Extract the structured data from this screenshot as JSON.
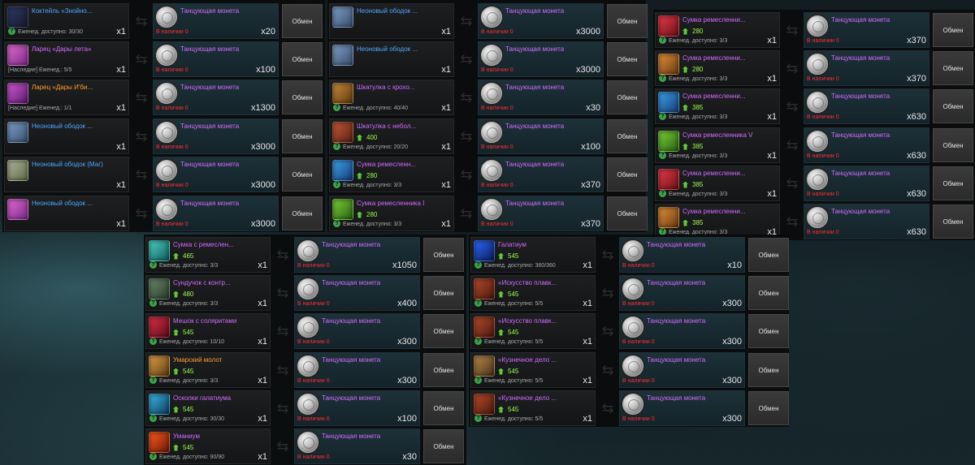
{
  "colors": {
    "item_name_blue": "#4fa6ff",
    "item_name_purple": "#d26bff",
    "item_name_orange": "#ff9d2a",
    "price_green": "#9cff4a",
    "stock_red": "#ff2d2d"
  },
  "common": {
    "currency_name": "Танцующая монета",
    "in_stock_text": "В наличии 0",
    "exchange_label": "Обмен"
  },
  "panels": [
    {
      "rows": [
        {
          "icon": "cocktail-icon",
          "icon_class": "ic-cocktail",
          "name": "Коктейль «Знойно...",
          "name_color": "blue",
          "price": "",
          "stock": "Еженед. доступно: 30/30",
          "qmark": true,
          "qty": "x1",
          "cost": "x20"
        },
        {
          "icon": "chest-icon",
          "icon_class": "ic-chest-pink",
          "name": "Ларец «Дары лета»",
          "name_color": "purple",
          "price": "",
          "stock": "[Наследие] Еженед.: 5/5",
          "qmark": false,
          "qty": "x1",
          "cost": "x100"
        },
        {
          "icon": "chest-icon",
          "icon_class": "ic-chest-purple",
          "name": "Ларец «Дары И'би...",
          "name_color": "orange",
          "price": "",
          "stock": "[Наследие] Еженед.: 1/1",
          "qmark": false,
          "qty": "x1",
          "cost": "x1300"
        },
        {
          "icon": "neon-rim-icon",
          "icon_class": "ic-chest-neon",
          "name": "Неоновый ободок ...",
          "name_color": "blue",
          "price": "",
          "stock": "",
          "qmark": false,
          "qty": "x1",
          "cost": "x3000"
        },
        {
          "icon": "neon-rim-icon",
          "icon_class": "ic-chest-green",
          "name": "Неоновый ободок (Маг)",
          "name_color": "blue",
          "price": "",
          "stock": "",
          "qmark": false,
          "qty": "x1",
          "cost": "x3000"
        },
        {
          "icon": "neon-rim-icon",
          "icon_class": "ic-chest-pink",
          "name": "Неоновый ободок ...",
          "name_color": "blue",
          "price": "",
          "stock": "",
          "qmark": false,
          "qty": "x1",
          "cost": "x3000"
        }
      ]
    },
    {
      "rows": [
        {
          "icon": "neon-rim-icon",
          "icon_class": "ic-chest-neon",
          "name": "Неоновый ободок ...",
          "name_color": "blue",
          "price": "",
          "stock": "",
          "qmark": false,
          "qty": "x1",
          "cost": "x3000"
        },
        {
          "icon": "neon-rim-icon",
          "icon_class": "ic-chest-neon",
          "name": "Неоновый ободок ...",
          "name_color": "blue",
          "price": "",
          "stock": "",
          "qmark": false,
          "qty": "x1",
          "cost": "x3000"
        },
        {
          "icon": "box-icon",
          "icon_class": "ic-box-brown",
          "name": "Шкатулка с крохо...",
          "name_color": "purple",
          "price": "",
          "stock": "Еженед. доступно: 40/40",
          "qmark": true,
          "qty": "x1",
          "cost": "x30"
        },
        {
          "icon": "box-icon",
          "icon_class": "ic-box-red",
          "name": "Шкатулка с небол...",
          "name_color": "purple",
          "price": "400",
          "stock": "Еженед. доступно: 20/20",
          "qmark": true,
          "qty": "x1",
          "cost": "x100"
        },
        {
          "icon": "bag-icon",
          "icon_class": "ic-bag-blue",
          "name": "Сумка ремесленн...",
          "name_color": "purple",
          "price": "280",
          "stock": "Еженед. доступно: 3/3",
          "qmark": true,
          "qty": "x1",
          "cost": "x370"
        },
        {
          "icon": "bag-icon",
          "icon_class": "ic-bag-green",
          "name": "Сумка ремесленника I",
          "name_color": "purple",
          "price": "280",
          "stock": "Еженед. доступно: 3/3",
          "qmark": true,
          "qty": "x1",
          "cost": "x370"
        }
      ]
    },
    {
      "rows": [
        {
          "icon": "bag-icon",
          "icon_class": "ic-bag-red",
          "name": "Сумка ремесленни...",
          "name_color": "purple",
          "price": "280",
          "stock": "Еженед. доступно: 3/3",
          "qmark": true,
          "qty": "x1",
          "cost": "x370"
        },
        {
          "icon": "bag-icon",
          "icon_class": "ic-bag-orange",
          "name": "Сумка ремесленни...",
          "name_color": "purple",
          "price": "280",
          "stock": "Еженед. доступно: 3/3",
          "qmark": true,
          "qty": "x1",
          "cost": "x370"
        },
        {
          "icon": "bag-icon",
          "icon_class": "ic-bag-blue",
          "name": "Сумка ремесленни...",
          "name_color": "purple",
          "price": "385",
          "stock": "Еженед. доступно: 3/3",
          "qmark": true,
          "qty": "x1",
          "cost": "x630"
        },
        {
          "icon": "bag-icon",
          "icon_class": "ic-bag-green",
          "name": "Сумка ремесленника V",
          "name_color": "purple",
          "price": "385",
          "stock": "Еженед. доступно: 3/3",
          "qmark": true,
          "qty": "x1",
          "cost": "x630"
        },
        {
          "icon": "bag-icon",
          "icon_class": "ic-bag-red",
          "name": "Сумка ремесленни...",
          "name_color": "purple",
          "price": "385",
          "stock": "Еженед. доступно: 3/3",
          "qmark": true,
          "qty": "x1",
          "cost": "x630"
        },
        {
          "icon": "bag-icon",
          "icon_class": "ic-bag-orange",
          "name": "Сумка ремесленни...",
          "name_color": "purple",
          "price": "385",
          "stock": "Еженед. доступно: 3/3",
          "qmark": true,
          "qty": "x1",
          "cost": "x630"
        }
      ]
    },
    {
      "rows": [
        {
          "icon": "bag-icon",
          "icon_class": "ic-bag-teal",
          "name": "Сумка с ремеслен...",
          "name_color": "purple",
          "price": "465",
          "stock": "Еженед. доступно: 3/3",
          "qmark": true,
          "qty": "x1",
          "cost": "x1050"
        },
        {
          "icon": "chest-icon",
          "icon_class": "ic-chest-dark",
          "name": "Сундучок с контр...",
          "name_color": "purple",
          "price": "480",
          "stock": "Еженед. доступно: 3/3",
          "qmark": true,
          "qty": "x1",
          "cost": "x400"
        },
        {
          "icon": "sack-icon",
          "icon_class": "ic-sack-red",
          "name": "Мешок с соляритами",
          "name_color": "purple",
          "price": "545",
          "stock": "Еженед. доступно: 10/10",
          "qmark": true,
          "qty": "x1",
          "cost": "x300"
        },
        {
          "icon": "hammer-icon",
          "icon_class": "ic-hammer",
          "name": "Умарский молот",
          "name_color": "orange",
          "price": "545",
          "stock": "Еженед. доступно: 3/3",
          "qmark": true,
          "qty": "x1",
          "cost": "x300"
        },
        {
          "icon": "shards-icon",
          "icon_class": "ic-shards",
          "name": "Осколки галатиума",
          "name_color": "purple",
          "price": "545",
          "stock": "Еженед. доступно: 30/30",
          "qmark": true,
          "qty": "x1",
          "cost": "x100"
        },
        {
          "icon": "ore-icon",
          "icon_class": "ic-ore",
          "name": "Уманиум",
          "name_color": "purple",
          "price": "545",
          "stock": "Еженед. доступно: 90/90",
          "qmark": true,
          "qty": "x1",
          "cost": "x30"
        }
      ]
    },
    {
      "rows": [
        {
          "icon": "crystal-icon",
          "icon_class": "ic-crystal-blue",
          "name": "Галатиум",
          "name_color": "purple",
          "price": "545",
          "stock": "Еженед. доступно: 360/360",
          "qmark": true,
          "qty": "x1",
          "cost": "x10"
        },
        {
          "icon": "book-icon",
          "icon_class": "ic-book-red",
          "name": "«Искусство плавк...",
          "name_color": "purple",
          "price": "545",
          "stock": "Еженед. доступно: 5/5",
          "qmark": true,
          "qty": "x1",
          "cost": "x300"
        },
        {
          "icon": "book-icon",
          "icon_class": "ic-book-red",
          "name": "«Искусство плавк...",
          "name_color": "purple",
          "price": "545",
          "stock": "Еженед. доступно: 5/5",
          "qmark": true,
          "qty": "x1",
          "cost": "x300"
        },
        {
          "icon": "book-icon",
          "icon_class": "ic-book-brown",
          "name": "«Кузнечное дело ...",
          "name_color": "purple",
          "price": "545",
          "stock": "Еженед. доступно: 5/5",
          "qmark": true,
          "qty": "x1",
          "cost": "x300"
        },
        {
          "icon": "book-icon",
          "icon_class": "ic-book-red",
          "name": "«Кузнечное дело ...",
          "name_color": "purple",
          "price": "545",
          "stock": "Еженед. доступно: 5/5",
          "qmark": true,
          "qty": "x1",
          "cost": "x300"
        }
      ]
    }
  ]
}
